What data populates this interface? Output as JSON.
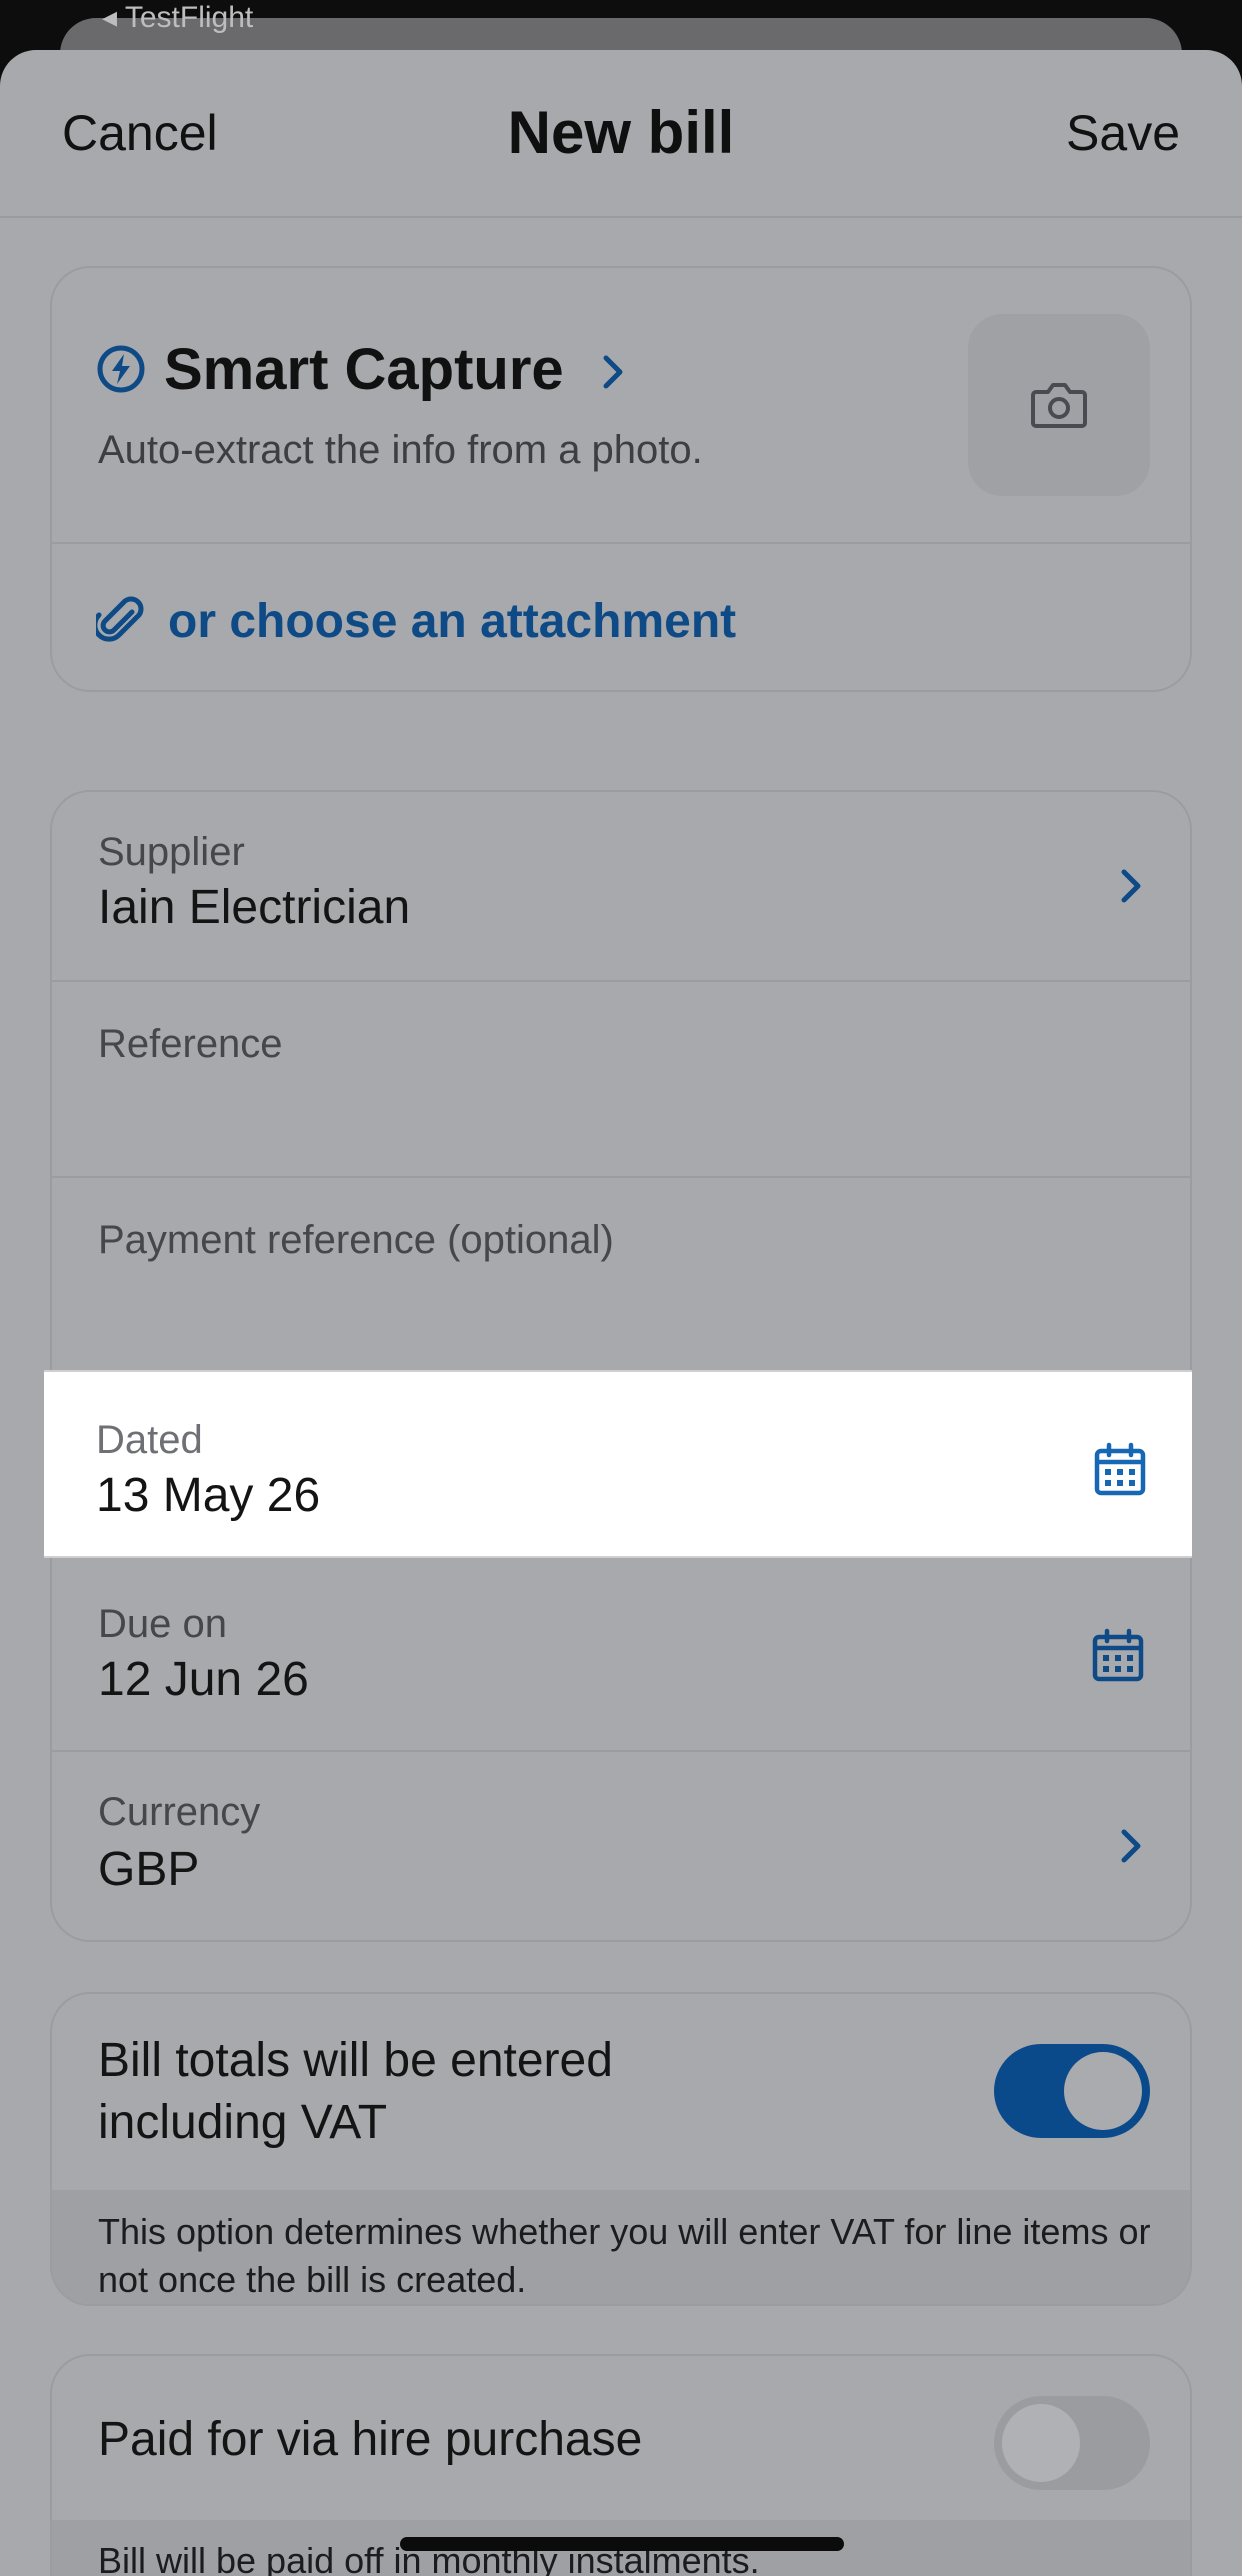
{
  "status_bar": {
    "back_label": "◂ TestFlight"
  },
  "nav": {
    "cancel_label": "Cancel",
    "title": "New bill",
    "save_label": "Save"
  },
  "smart_capture": {
    "title": "Smart Capture",
    "subtitle": "Auto-extract the info from a photo.",
    "attachment_label": "or choose an attachment",
    "icons": [
      "bolt-icon",
      "chevron-right-icon",
      "camera-icon",
      "paperclip-icon"
    ]
  },
  "fields": {
    "supplier": {
      "label": "Supplier",
      "value": "Iain Electrician"
    },
    "reference": {
      "label": "Reference",
      "value": ""
    },
    "payment_reference": {
      "label": "Payment reference (optional)",
      "value": ""
    },
    "dated": {
      "label": "Dated",
      "value": "13 May 26"
    },
    "due_on": {
      "label": "Due on",
      "value": "12 Jun 26"
    },
    "currency": {
      "label": "Currency",
      "value": "GBP"
    }
  },
  "vat": {
    "label": "Bill totals will be entered including VAT",
    "toggle_on": true,
    "note": "This option determines whether you will enter VAT for line items or not once the bill is created."
  },
  "hire_purchase": {
    "label": "Paid for via hire purchase",
    "toggle_on": false,
    "note": "Bill will be paid off in monthly instalments."
  },
  "colors": {
    "accent": "#0b4a8a",
    "link": "#0e4a86",
    "sheet": "#a8a9ad"
  }
}
